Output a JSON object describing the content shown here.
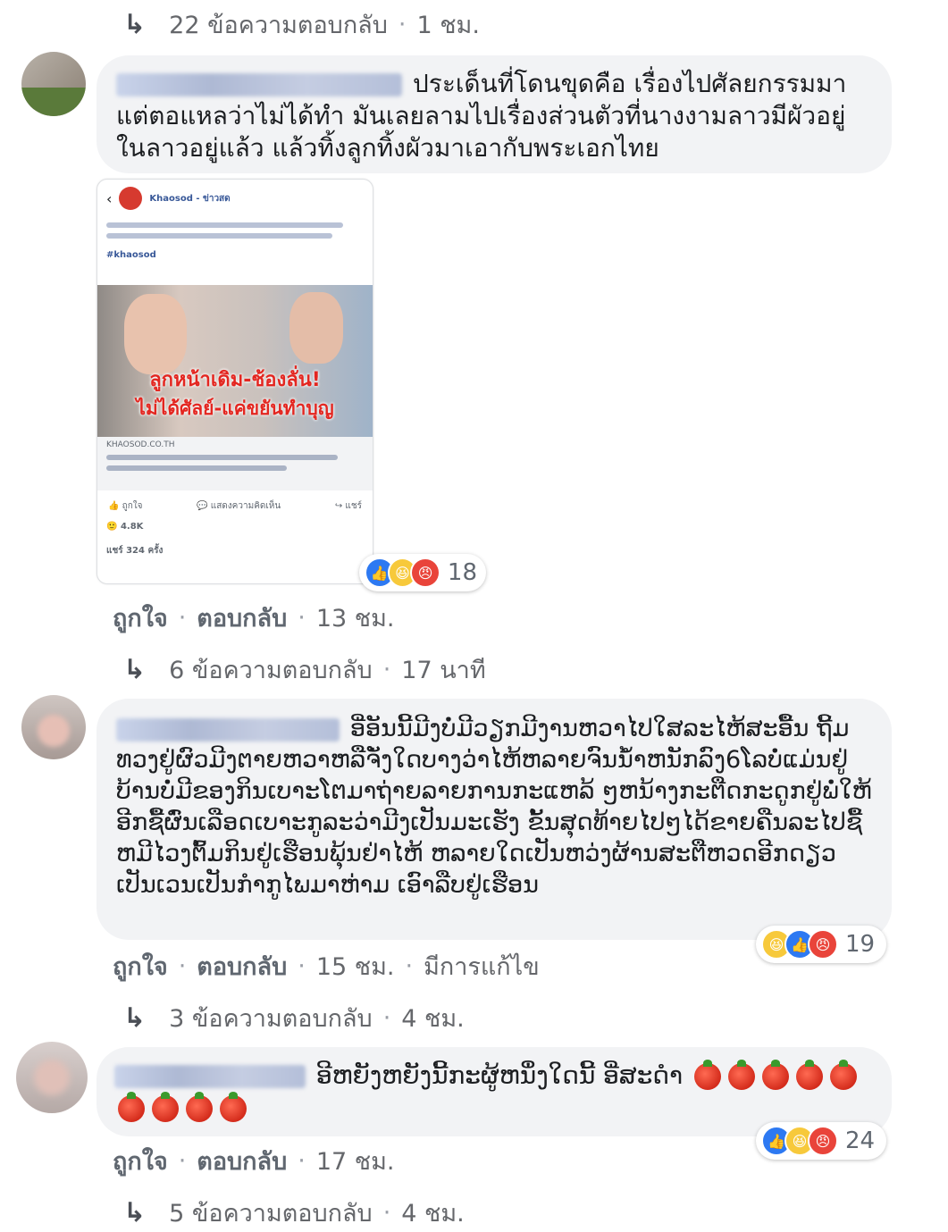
{
  "thread": {
    "top_replies": {
      "count": "22 ข้อความตอบกลับ",
      "time": "1 ชม."
    },
    "comments": [
      {
        "text": "ประเด็นที่โดนขุดคือ เรื่องไปศัลยกรรมมา แต่ตอแหลว่าไม่ได้ทำ มันเลยลามไปเรื่องส่วนตัวที่นางงามลาวมีผัวอยู่ในลาวอยู่แล้ว แล้วทิ้งลูกทิ้งผัวมาเอากับพระเอกไทย",
        "like": "ถูกใจ",
        "reply": "ตอบกลับ",
        "time": "13 ชม.",
        "reaction_count": "18",
        "replies": {
          "count": "6 ข้อความตอบกลับ",
          "time": "17 นาที"
        },
        "shared_post": {
          "page_name": "Khaosod - ข่าวสด",
          "headline_overlay_1": "ลูกหน้าเดิม-ช้องลั่น!",
          "headline_overlay_2": "ไม่ได้ศัลย์-แค่ขยันทำบุญ",
          "hashtag": "#khaosod",
          "domain": "KHAOSOD.CO.TH",
          "btn_like": "ถูกใจ",
          "btn_comment": "แสดงความคิดเห็น",
          "btn_share": "แชร์",
          "reaction_total": "4.8K",
          "shares": "แชร์ 324 ครั้ง"
        }
      },
      {
        "text": "ອີ່ອັນນີ້ມີງບໍ່ມີວຽກມີງານຫວາໄປໃສລະໄຫ້ສະອື້ນ ຖີ້ມທວງຢູ່ຜົວມີງຕາຍຫວາຫລືຈັ່ງໃດບາງວ່າໄຫ້ຫລາຍຈົນນ້ຳຫນັກລົງ6ໂລບໍ່ແມ່ນຢູ່ບ້ານບໍ່ມີຂອງກິນເບາະໂຕມາຖ່າຍລາຍການກະແຫລ້ ໆຫນ້າງກະຕືດກະດູກຢູ່ພໍ່ໃຫ້ອີກຊື້ຜົ່ນເລືອດເບາະກູລະວ່າມີງເປັນມະເຮັງ ຂັ້ນສຸດທ້າຍໄປໆໄດ້ຂາຍຄືນລະໄປຊື້ຫມີໄວງຕົ້ມກິນຢູ່ເຮືອນພຸ້ນຢ່າໄຫ້ ຫລາຍໃດເປັນຫວ່ງຜ້ານສະຕືຫວດອີກດຽວເປັນເວນເປັນກຳກູໄພມາຫ່າມ ເອົາລືບຢູ່ເຮືອນ",
        "like": "ถูกใจ",
        "reply": "ตอบกลับ",
        "time": "15 ชม.",
        "edited": "มีการแก้ไข",
        "reaction_count": "19",
        "replies": {
          "count": "3 ข้อความตอบกลับ",
          "time": "4 ชม."
        }
      },
      {
        "text": "ອີຫຍັງຫຍັງນີ້ກະຜູ້ຫນຶ່ງໃດນີ້ ອີ່ສະດຳ",
        "like": "ถูกใจ",
        "reply": "ตอบกลับ",
        "time": "17 ชม.",
        "reaction_count": "24",
        "replies": {
          "count": "5 ข้อความตอบกลับ",
          "time": "4 ชม."
        }
      }
    ]
  },
  "colors": {
    "bubble": "#f2f3f5",
    "meta": "#65676b",
    "like_blue": "#2d79f2",
    "angry_red": "#e9443a",
    "haha_yellow": "#f7c93b"
  },
  "icons": {
    "reply_arrow": "reply-arrow-icon",
    "tomato": "tomato-emoji-icon"
  }
}
